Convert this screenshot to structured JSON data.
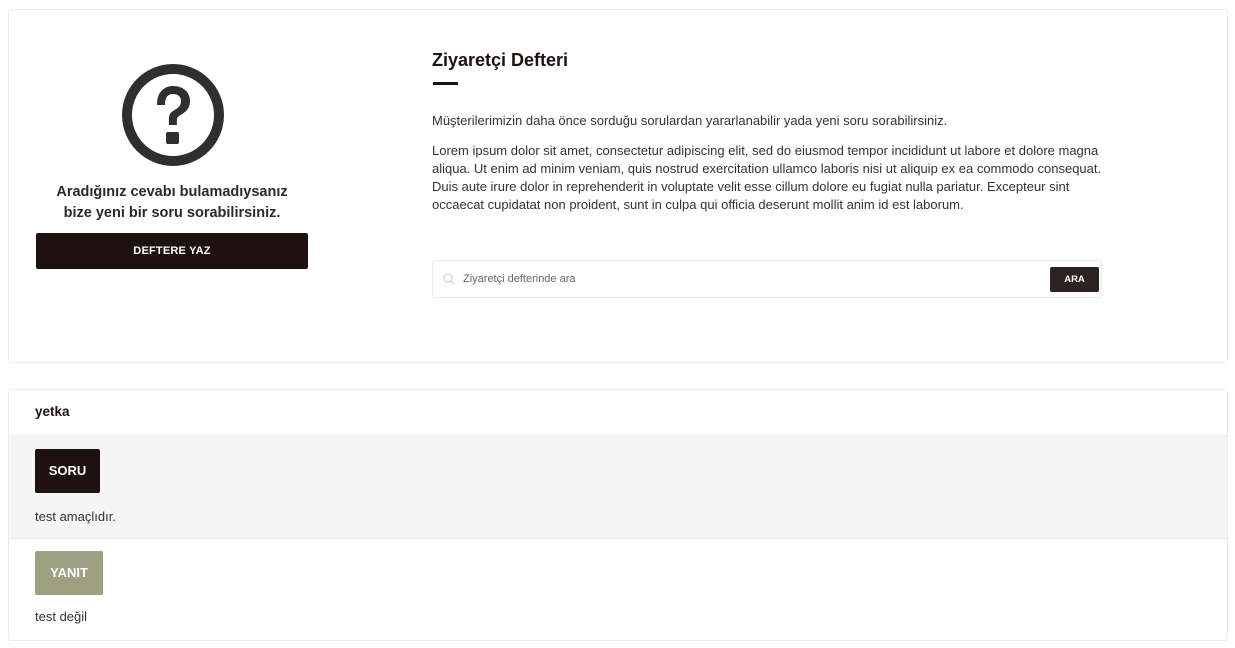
{
  "ask_panel": {
    "icon": "question-circle-icon",
    "text_line1": "Aradığınız cevabı bulamadıysanız",
    "text_line2": "bize yeni bir soru sorabilirsiniz.",
    "button_label": "DEFTERE YAZ"
  },
  "guestbook": {
    "title": "Ziyaretçi Defteri",
    "intro": "Müşterilerimizin daha önce sorduğu sorulardan yararlanabilir yada yeni soru sorabilirsiniz.",
    "description": "Lorem ipsum dolor sit amet, consectetur adipiscing elit, sed do eiusmod tempor incididunt ut labore et dolore magna aliqua. Ut enim ad minim veniam, quis nostrud exercitation ullamco laboris nisi ut aliquip ex ea commodo consequat. Duis aute irure dolor in reprehenderit in voluptate velit esse cillum dolore eu fugiat nulla pariatur. Excepteur sint occaecat cupidatat non proident, sunt in culpa qui officia deserunt mollit anim id est laborum."
  },
  "search": {
    "placeholder": "Ziyaretçi defterinde ara",
    "value": "",
    "button_label": "ARA",
    "icon": "search-icon"
  },
  "entries": [
    {
      "author": "yetka",
      "question_badge": "SORU",
      "question": "test amaçlıdır.",
      "answer_badge": "YANIT",
      "answer": "test değil"
    }
  ],
  "colors": {
    "primary": "#1e1210",
    "answer_badge": "#9ea084",
    "question_bg": "#f5f5f5",
    "border": "#ececec"
  }
}
